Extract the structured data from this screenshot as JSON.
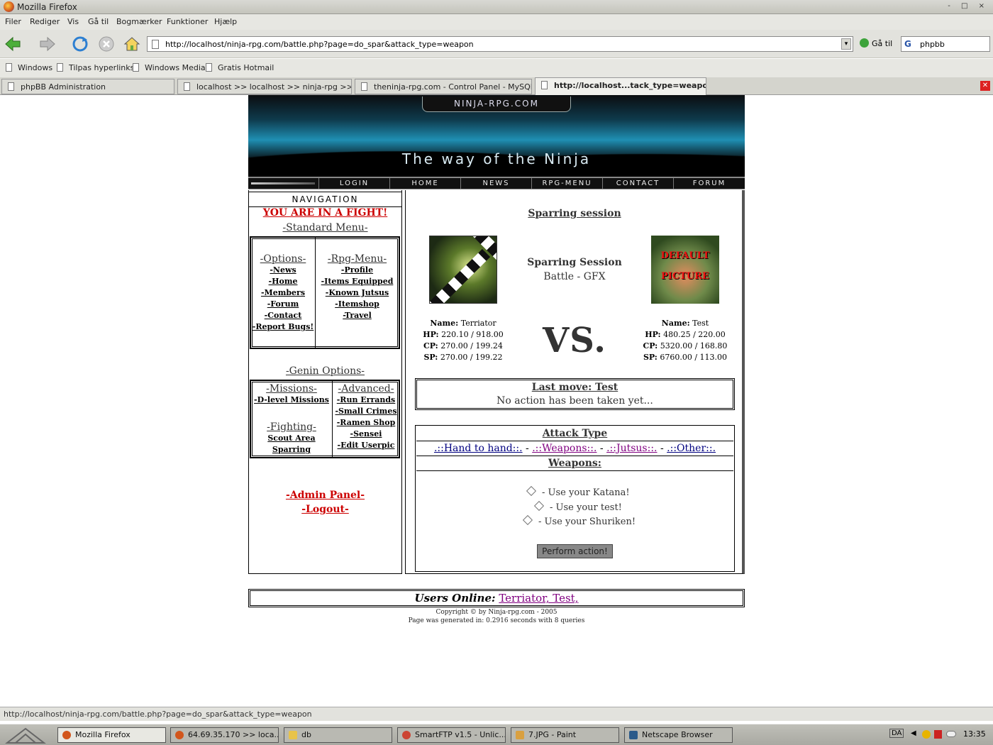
{
  "window": {
    "title": "Mozilla Firefox",
    "controls": "- □ ×"
  },
  "menubar": [
    "Filer",
    "Rediger",
    "Vis",
    "Gå til",
    "Bogmærker",
    "Funktioner",
    "Hjælp"
  ],
  "toolbar": {
    "url": "http://localhost/ninja-rpg.com/battle.php?page=do_spar&attack_type=weapon",
    "go_label": "Gå til",
    "search_value": "phpbb"
  },
  "bookmarks": [
    "Windows",
    "Tilpas hyperlinks",
    "Windows Media",
    "Gratis Hotmail"
  ],
  "tabs": [
    "phpBB Administration",
    "localhost >> localhost >> ninja-rpg  >> ...",
    "theninja-rpg.com - Control Panel - MySQL ...",
    "http://localhost...tack_type=weapon"
  ],
  "site": {
    "logo": "NINJA-RPG.COM",
    "slogan": "The way of the Ninja",
    "topnav": [
      "LOGIN",
      "HOME",
      "NEWS",
      "RPG-MENU",
      "CONTACT",
      "FORUM"
    ]
  },
  "nav": {
    "heading": "NAVIGATION",
    "fight_notice": "YOU ARE IN A FIGHT!",
    "standard_title": "-Standard Menu-",
    "options_title": "-Options-",
    "options": [
      "-News",
      "-Home",
      "-Members",
      "-Forum",
      "-Contact",
      "-Report Bugs!"
    ],
    "rpg_title": "-Rpg-Menu-",
    "rpg": [
      "-Profile",
      "-Items Equipped",
      "-Known Jutsus",
      "-Itemshop",
      "-Travel"
    ],
    "genin_title": "-Genin Options-",
    "missions_title": "-Missions-",
    "missions": [
      "-D-level Missions"
    ],
    "fighting_title": "-Fighting-",
    "fighting": [
      "Scout Area",
      "Sparring"
    ],
    "advanced_title": "-Advanced-",
    "advanced": [
      "-Run Errands",
      "-Small Crimes",
      "-Ramen Shop",
      "-Sensei",
      "-Edit Userpic"
    ],
    "admin": "-Admin Panel-",
    "logout": "-Logout-"
  },
  "battle": {
    "title": "Sparring session",
    "session_label": "Sparring Session",
    "session_sub": "Battle - GFX",
    "vs": "VS.",
    "player1": {
      "name_label": "Name:",
      "name": "Terriator",
      "hp": "220.10 / 918.00",
      "cp": "270.00 / 199.24",
      "sp": "270.00 / 199.22"
    },
    "player2": {
      "name_label": "Name:",
      "name": "Test",
      "hp": "480.25 / 220.00",
      "cp": "5320.00 / 168.80",
      "sp": "6760.00 / 113.00",
      "picture_text": "DEFAULT PICTURE"
    },
    "labels": {
      "hp": "HP:",
      "cp": "CP:",
      "sp": "SP:"
    },
    "last_move_title": "Last move: Test",
    "last_move_text": "No action has been taken yet...",
    "attack_type_title": "Attack Type",
    "attack_types": {
      "hand": ".::Hand to hand::.",
      "weapons": ".::Weapons::.",
      "jutsus": ".::Jutsus::.",
      "other": ".::Other::.",
      "sep": "-"
    },
    "weapons_title": "Weapons:",
    "weapon_options": [
      "- Use your Katana!",
      "- Use your test!",
      "- Use your Shuriken!"
    ],
    "perform_label": "Perform action!"
  },
  "footer": {
    "users_online_label": "Users Online:",
    "users_online": "Terriator, Test,",
    "copyright": "Copyright © by Ninja-rpg.com - 2005",
    "generated": "Page was generated in: 0.2916 seconds with 8 queries"
  },
  "statusbar": "http://localhost/ninja-rpg.com/battle.php?page=do_spar&attack_type=weapon",
  "taskbar": {
    "items": [
      "Mozilla Firefox",
      "64.69.35.170 >> loca...",
      "db",
      "SmartFTP v1.5 - Unlic...",
      "7.JPG - Paint",
      "Netscape Browser"
    ],
    "lang": "DA",
    "clock": "13:35"
  },
  "colors": {
    "accent_red": "#cc0000",
    "link_navy": "#000080",
    "link_purple": "#800080"
  }
}
